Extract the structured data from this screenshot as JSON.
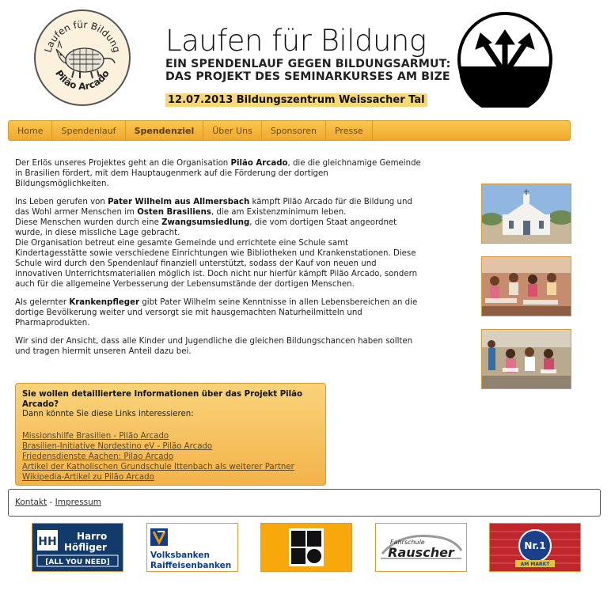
{
  "header": {
    "logo_arc_top": "Laufen für Bildung",
    "logo_arc_bottom": "Pilão Arcado",
    "title": "Laufen für Bildung",
    "subtitle_line1": "EIN SPENDENLAUF GEGEN BILDUNGSARMUT:",
    "subtitle_line2": "DAS PROJEKT DES SEMINARKURSES AM BIZE",
    "date_line": "12.07.2013 Bildungszentrum Weissacher Tal"
  },
  "nav": {
    "items": [
      {
        "label": "Home"
      },
      {
        "label": "Spendenlauf"
      },
      {
        "label": "Spendenziel",
        "active": true
      },
      {
        "label": "Über Uns"
      },
      {
        "label": "Sponsoren"
      },
      {
        "label": "Presse"
      }
    ]
  },
  "content": {
    "p1_a": "Der Erlös unseres Projektes geht an die Organisation ",
    "p1_b": "Pilão Arcado",
    "p1_c": ", die die gleichnamige Gemeinde in Brasilien fördert, mit dem Hauptaugenmerk auf die Förderung der dortigen Bildungsmöglichkeiten.",
    "p2_a": "Ins Leben gerufen von ",
    "p2_b": "Pater Wilhelm aus Allmersbach",
    "p2_c": " kämpft Pilão Arcado für die Bildung und das Wohl armer Menschen im ",
    "p2_d": "Osten Brasiliens",
    "p2_e": ", die am Existenzminimum leben.",
    "p2_f": "Diese Menschen wurden durch eine ",
    "p2_g": "Zwangsumsiedlung",
    "p2_h": ", die vom dortigen Staat angeordnet wurde, in diese missliche Lage gebracht.",
    "p2_i": "Die Organisation betreut eine gesamte Gemeinde und errichtete eine Schule samt Kindertagesstätte sowie verschiedene Einrichtungen wie Bibliotheken und Krankenstationen. Diese Schule wird durch den Spendenlauf finanziell unterstützt, sodass der Kauf von neuen und innovativen Unterrichtsmaterialien möglich ist. Doch nicht nur hierfür kämpft Pilão Arcado, sondern auch für die allgemeine Verbesserung der Lebensumstände der dortigen Menschen.",
    "p3_a": "Als gelernter ",
    "p3_b": "Krankenpfleger",
    "p3_c": " gibt Pater Wilhelm seine Kenntnisse in allen Lebensbereichen an die dortige Bevölkerung weiter und versorgt sie mit hausgemachten Naturheilmitteln und Pharmaprodukten.",
    "p4": "Wir sind der Ansicht, dass alle Kinder und Jugendliche die gleichen Bildungschancen haben sollten und tragen hiermit unseren Anteil dazu bei."
  },
  "infobox": {
    "question": "Sie wollen detailliertere Informationen über das Projekt Pilão Arcado?",
    "intro": "Dann könnte Sie diese Links interessieren:",
    "links": [
      {
        "label": "Missionshilfe Brasilien - Pilão Arcado "
      },
      {
        "label": "Brasilien-Initiative Nordestino eV - Pilão Arcado"
      },
      {
        "label": "Friedensdienste Aachen: Pilao Arcado"
      },
      {
        "label": "Artikel der Katholischen Grundschule Ittenbach als weiterer Partner"
      },
      {
        "label": "Wikipedia-Artikel zu Pilão Arcado"
      }
    ]
  },
  "footer": {
    "kontakt": "Kontakt",
    "separator": " - ",
    "impressum": "Impressum"
  },
  "sponsors": {
    "harro_line1": "Harro",
    "harro_line2": "Höfliger",
    "harro_tag": "[ALL YOU NEED]",
    "harro_mark": "HH",
    "volksbank_line1": "Volksbanken",
    "volksbank_line2": "Raiffeisenbanken",
    "rauscher_small": "Fahrschule",
    "rauscher_name": "Rauscher",
    "nr1_text": "Nr.1",
    "nr1_small": "AM MARKT"
  },
  "colors": {
    "accent": "#f4b03a",
    "accent_border": "#d99c2b",
    "date_highlight": "#f7d877",
    "harro_blue": "#123a6b",
    "volksbank_blue": "#0b3f8a",
    "volksbank_orange": "#f39200",
    "nr1_red": "#c0272d"
  }
}
